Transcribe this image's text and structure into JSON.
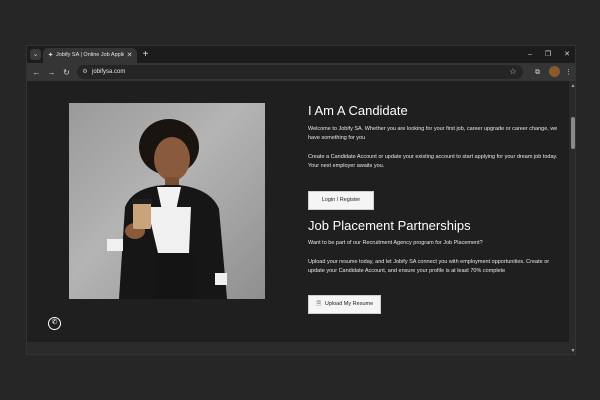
{
  "browser": {
    "tab_title": "Jobify SA | Online Job Applica",
    "url": "jobifysa.com",
    "icons": {
      "tab_menu": "chevron-down-icon",
      "favicon": "jobify-favicon",
      "tab_close": "close-icon",
      "new_tab": "plus-icon",
      "back": "back-arrow-icon",
      "forward": "forward-arrow-icon",
      "reload": "reload-icon",
      "site_info": "tune-icon",
      "bookmark": "star-icon",
      "extensions": "puzzle-icon",
      "profile": "avatar",
      "menu": "kebab-menu-icon",
      "minimize": "minimize-icon",
      "maximize": "restore-icon",
      "close": "close-icon"
    },
    "glyphs": {
      "tab_menu": "⌄",
      "favicon": "✦",
      "tab_close": "✕",
      "new_tab": "+",
      "back": "←",
      "forward": "→",
      "reload": "↻",
      "site_info": "⚙",
      "bookmark": "☆",
      "extensions": "⧉",
      "menu": "⋮",
      "minimize": "–",
      "maximize": "❐",
      "close": "✕"
    }
  },
  "page": {
    "candidate": {
      "heading": "I Am A Candidate",
      "paragraph1": "Welcome to Jobify SA.  Whether you are looking for your first job, career upgrade or career change, we have something for you",
      "paragraph2": "Create a Candidate Account or update your existing account to start applying for your dream job today. Your next employer awaits you.",
      "button": "Login / Register"
    },
    "placement": {
      "heading": "Job Placement Partnerships",
      "paragraph1": "Want to be part of our Recruitment Agency program for Job Placement?",
      "paragraph2": "Upload your resume today, and let Jobify SA connect you with employment opportunities. Create or update your Candidate Account, and ensure your profile is at least 70% complete",
      "button": "Upload My Resume",
      "button_icon": "document-icon"
    },
    "whatsapp_icon": "whatsapp-icon"
  }
}
